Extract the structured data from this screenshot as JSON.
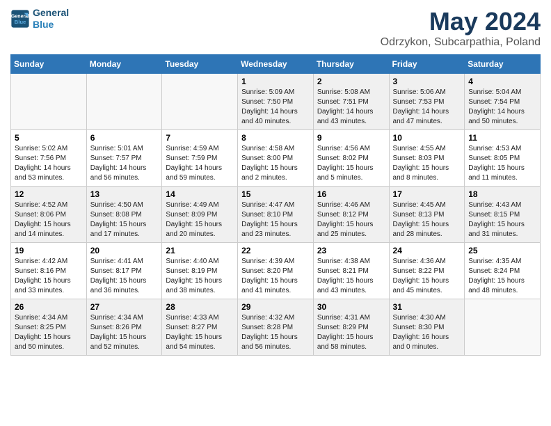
{
  "header": {
    "logo_line1": "General",
    "logo_line2": "Blue",
    "title": "May 2024",
    "subtitle": "Odrzykon, Subcarpathia, Poland"
  },
  "weekdays": [
    "Sunday",
    "Monday",
    "Tuesday",
    "Wednesday",
    "Thursday",
    "Friday",
    "Saturday"
  ],
  "weeks": [
    [
      {
        "day": "",
        "info": ""
      },
      {
        "day": "",
        "info": ""
      },
      {
        "day": "",
        "info": ""
      },
      {
        "day": "1",
        "info": "Sunrise: 5:09 AM\nSunset: 7:50 PM\nDaylight: 14 hours\nand 40 minutes."
      },
      {
        "day": "2",
        "info": "Sunrise: 5:08 AM\nSunset: 7:51 PM\nDaylight: 14 hours\nand 43 minutes."
      },
      {
        "day": "3",
        "info": "Sunrise: 5:06 AM\nSunset: 7:53 PM\nDaylight: 14 hours\nand 47 minutes."
      },
      {
        "day": "4",
        "info": "Sunrise: 5:04 AM\nSunset: 7:54 PM\nDaylight: 14 hours\nand 50 minutes."
      }
    ],
    [
      {
        "day": "5",
        "info": "Sunrise: 5:02 AM\nSunset: 7:56 PM\nDaylight: 14 hours\nand 53 minutes."
      },
      {
        "day": "6",
        "info": "Sunrise: 5:01 AM\nSunset: 7:57 PM\nDaylight: 14 hours\nand 56 minutes."
      },
      {
        "day": "7",
        "info": "Sunrise: 4:59 AM\nSunset: 7:59 PM\nDaylight: 14 hours\nand 59 minutes."
      },
      {
        "day": "8",
        "info": "Sunrise: 4:58 AM\nSunset: 8:00 PM\nDaylight: 15 hours\nand 2 minutes."
      },
      {
        "day": "9",
        "info": "Sunrise: 4:56 AM\nSunset: 8:02 PM\nDaylight: 15 hours\nand 5 minutes."
      },
      {
        "day": "10",
        "info": "Sunrise: 4:55 AM\nSunset: 8:03 PM\nDaylight: 15 hours\nand 8 minutes."
      },
      {
        "day": "11",
        "info": "Sunrise: 4:53 AM\nSunset: 8:05 PM\nDaylight: 15 hours\nand 11 minutes."
      }
    ],
    [
      {
        "day": "12",
        "info": "Sunrise: 4:52 AM\nSunset: 8:06 PM\nDaylight: 15 hours\nand 14 minutes."
      },
      {
        "day": "13",
        "info": "Sunrise: 4:50 AM\nSunset: 8:08 PM\nDaylight: 15 hours\nand 17 minutes."
      },
      {
        "day": "14",
        "info": "Sunrise: 4:49 AM\nSunset: 8:09 PM\nDaylight: 15 hours\nand 20 minutes."
      },
      {
        "day": "15",
        "info": "Sunrise: 4:47 AM\nSunset: 8:10 PM\nDaylight: 15 hours\nand 23 minutes."
      },
      {
        "day": "16",
        "info": "Sunrise: 4:46 AM\nSunset: 8:12 PM\nDaylight: 15 hours\nand 25 minutes."
      },
      {
        "day": "17",
        "info": "Sunrise: 4:45 AM\nSunset: 8:13 PM\nDaylight: 15 hours\nand 28 minutes."
      },
      {
        "day": "18",
        "info": "Sunrise: 4:43 AM\nSunset: 8:15 PM\nDaylight: 15 hours\nand 31 minutes."
      }
    ],
    [
      {
        "day": "19",
        "info": "Sunrise: 4:42 AM\nSunset: 8:16 PM\nDaylight: 15 hours\nand 33 minutes."
      },
      {
        "day": "20",
        "info": "Sunrise: 4:41 AM\nSunset: 8:17 PM\nDaylight: 15 hours\nand 36 minutes."
      },
      {
        "day": "21",
        "info": "Sunrise: 4:40 AM\nSunset: 8:19 PM\nDaylight: 15 hours\nand 38 minutes."
      },
      {
        "day": "22",
        "info": "Sunrise: 4:39 AM\nSunset: 8:20 PM\nDaylight: 15 hours\nand 41 minutes."
      },
      {
        "day": "23",
        "info": "Sunrise: 4:38 AM\nSunset: 8:21 PM\nDaylight: 15 hours\nand 43 minutes."
      },
      {
        "day": "24",
        "info": "Sunrise: 4:36 AM\nSunset: 8:22 PM\nDaylight: 15 hours\nand 45 minutes."
      },
      {
        "day": "25",
        "info": "Sunrise: 4:35 AM\nSunset: 8:24 PM\nDaylight: 15 hours\nand 48 minutes."
      }
    ],
    [
      {
        "day": "26",
        "info": "Sunrise: 4:34 AM\nSunset: 8:25 PM\nDaylight: 15 hours\nand 50 minutes."
      },
      {
        "day": "27",
        "info": "Sunrise: 4:34 AM\nSunset: 8:26 PM\nDaylight: 15 hours\nand 52 minutes."
      },
      {
        "day": "28",
        "info": "Sunrise: 4:33 AM\nSunset: 8:27 PM\nDaylight: 15 hours\nand 54 minutes."
      },
      {
        "day": "29",
        "info": "Sunrise: 4:32 AM\nSunset: 8:28 PM\nDaylight: 15 hours\nand 56 minutes."
      },
      {
        "day": "30",
        "info": "Sunrise: 4:31 AM\nSunset: 8:29 PM\nDaylight: 15 hours\nand 58 minutes."
      },
      {
        "day": "31",
        "info": "Sunrise: 4:30 AM\nSunset: 8:30 PM\nDaylight: 16 hours\nand 0 minutes."
      },
      {
        "day": "",
        "info": ""
      }
    ]
  ]
}
